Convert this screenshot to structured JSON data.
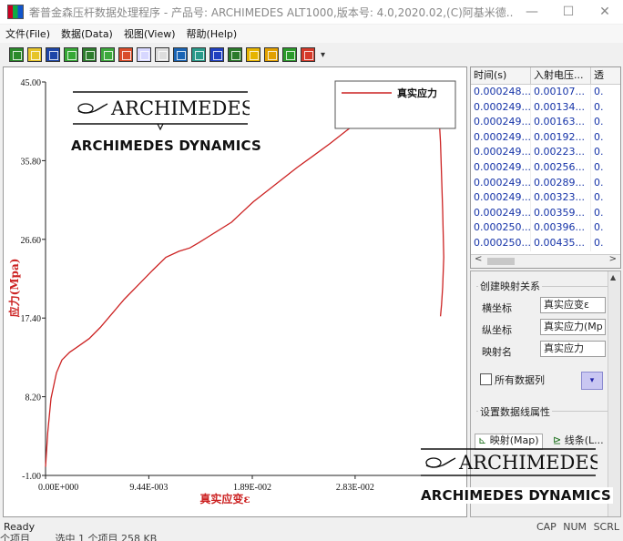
{
  "window": {
    "title": "奢普金森压杆数据处理程序 - 产品号: ARCHIMEDES ALT1000,版本号: 4.0,2020.02,(C)阿基米德...",
    "minimize": "—",
    "maximize": "☐",
    "close": "✕"
  },
  "menu": [
    "文件(File)",
    "数据(Data)",
    "视图(View)",
    "帮助(Help)"
  ],
  "toolbar": {
    "buttons": [
      {
        "icon": "open-folder-icon",
        "color": "#2a8a2a"
      },
      {
        "icon": "open-file-icon",
        "color": "#e6c42a"
      },
      {
        "icon": "save-icon",
        "color": "#1e46a8"
      },
      {
        "icon": "import-icon",
        "color": "#35a835"
      },
      {
        "icon": "table-icon",
        "color": "#2d7d2d"
      },
      {
        "icon": "grid-icon",
        "color": "#3ca83c"
      },
      {
        "icon": "chart-icon",
        "color": "#d94c2a"
      },
      {
        "icon": "mapping-icon",
        "color": "#d7d7ff"
      },
      {
        "icon": "curve-icon",
        "color": "#ddd"
      },
      {
        "icon": "refresh-icon",
        "color": "#1a64b4"
      },
      {
        "icon": "window-icon",
        "color": "#2a9a8a"
      },
      {
        "icon": "stop-icon",
        "color": "#2040c0"
      },
      {
        "icon": "color-icon",
        "color": "#2a7a2a"
      },
      {
        "icon": "help-icon",
        "color": "#e6b400"
      },
      {
        "icon": "edit-icon",
        "color": "#e2a000"
      },
      {
        "icon": "tools-icon",
        "color": "#2a9a2a"
      },
      {
        "icon": "export-icon",
        "color": "#d43a2a"
      }
    ],
    "more": "▾"
  },
  "chart_data": {
    "type": "line",
    "xlabel": "真实应变ε",
    "ylabel": "应力(Mpa)",
    "xticks": [
      "0.00E+000",
      "9.44E-003",
      "1.89E-002",
      "2.83E-002"
    ],
    "xtick_values": [
      0,
      0.00944,
      0.0189,
      0.0283
    ],
    "yticks": [
      "-1.00",
      "8.20",
      "17.40",
      "26.60",
      "35.80",
      "45.00"
    ],
    "xlim": [
      0,
      0.0378
    ],
    "ylim": [
      -1.0,
      45.0
    ],
    "legend_position": "top-right",
    "color": "#cc2222",
    "series": [
      {
        "name": "真实应力",
        "x": [
          0.0,
          0.0002,
          0.0005,
          0.001,
          0.0015,
          0.0022,
          0.003,
          0.004,
          0.005,
          0.006,
          0.0072,
          0.0085,
          0.0098,
          0.011,
          0.0122,
          0.0132,
          0.014,
          0.015,
          0.016,
          0.017,
          0.018,
          0.019,
          0.02,
          0.0215,
          0.023,
          0.0245,
          0.026,
          0.0275,
          0.029,
          0.03,
          0.031,
          0.032,
          0.033,
          0.034,
          0.0346,
          0.0352,
          0.0356,
          0.0359,
          0.0361,
          0.0363,
          0.0364,
          0.0363,
          0.0362,
          0.0361
        ],
        "y": [
          0.0,
          4.0,
          8.0,
          11.0,
          12.5,
          13.4,
          14.1,
          15.0,
          16.3,
          17.8,
          19.6,
          21.3,
          23.0,
          24.5,
          25.2,
          25.6,
          26.2,
          27.0,
          27.8,
          28.6,
          29.8,
          31.0,
          32.0,
          33.5,
          35.0,
          36.4,
          37.8,
          39.3,
          40.7,
          41.6,
          42.4,
          43.1,
          43.8,
          44.4,
          44.8,
          44.9,
          44.3,
          42.5,
          38.0,
          30.0,
          24.5,
          21.0,
          19.0,
          17.6
        ]
      }
    ]
  },
  "logo": {
    "brand": "ARCHIMEDES",
    "subtitle": "ARCHIMEDES DYNAMICS"
  },
  "table": {
    "headers": [
      "时间(s)",
      "入射电压...",
      "透"
    ],
    "rows": [
      [
        "0.000248...",
        "0.00107...",
        "0."
      ],
      [
        "0.000249...",
        "0.00134...",
        "0."
      ],
      [
        "0.000249...",
        "0.00163...",
        "0."
      ],
      [
        "0.000249...",
        "0.00192...",
        "0."
      ],
      [
        "0.000249...",
        "0.00223...",
        "0."
      ],
      [
        "0.000249...",
        "0.00256...",
        "0."
      ],
      [
        "0.000249...",
        "0.00289...",
        "0."
      ],
      [
        "0.000249...",
        "0.00323...",
        "0."
      ],
      [
        "0.000249...",
        "0.00359...",
        "0."
      ],
      [
        "0.000250...",
        "0.00396...",
        "0."
      ],
      [
        "0.000250...",
        "0.00435...",
        "0."
      ]
    ]
  },
  "mapping": {
    "group_title": "创建映射关系",
    "x_label": "横坐标",
    "x_value": "真实应变ε",
    "y_label": "纵坐标",
    "y_value": "真实应力(Mp",
    "name_label": "映射名",
    "name_value": "真实应力",
    "all_columns_label": "所有数据列",
    "color_btn": "▾"
  },
  "line_props": {
    "group_title": "设置数据线属性",
    "tab_map": "映射(Map)",
    "tab_line": "线条(L..."
  },
  "status": {
    "left": "Ready",
    "caps": "CAP",
    "num": "NUM",
    "scrl": "SCRL"
  },
  "explorer": {
    "items": "个项目",
    "selected": "选中 1 个项目  258 KB"
  }
}
